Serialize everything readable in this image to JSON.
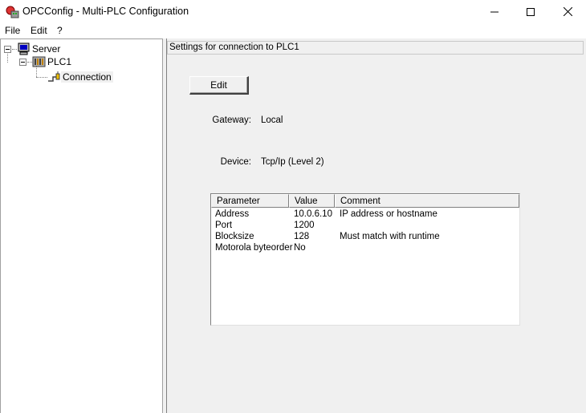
{
  "window": {
    "title": "OPCConfig - Multi-PLC Configuration",
    "minimize_glyph": "—",
    "maximize_glyph": "☐",
    "close_glyph": "✕"
  },
  "menu": {
    "file": "File",
    "edit": "Edit",
    "help": "?"
  },
  "tree": {
    "server": "Server",
    "plc": "PLC1",
    "connection": "Connection"
  },
  "settings": {
    "header": "Settings for connection to PLC1",
    "edit_button": "Edit",
    "gateway_label": "Gateway:",
    "gateway_value": "Local",
    "device_label": "Device:",
    "device_value": "Tcp/Ip (Level 2)"
  },
  "table": {
    "columns": [
      "Parameter",
      "Value",
      "Comment"
    ],
    "rows": [
      {
        "parameter": "Address",
        "value": "10.0.6.10",
        "comment": "IP address or hostname"
      },
      {
        "parameter": "Port",
        "value": "1200",
        "comment": ""
      },
      {
        "parameter": "Blocksize",
        "value": "128",
        "comment": "Must match with runtime"
      },
      {
        "parameter": "Motorola byteorder",
        "value": "No",
        "comment": ""
      }
    ]
  }
}
